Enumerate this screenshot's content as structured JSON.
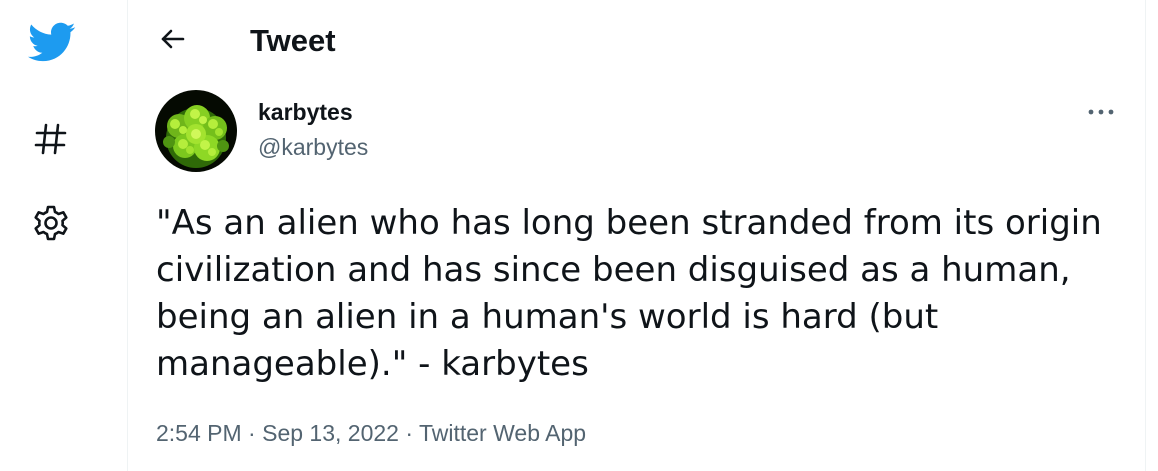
{
  "colors": {
    "brand": "#1d9bf0",
    "text_primary": "#0f1419",
    "text_secondary": "#536471",
    "border": "#eff3f4"
  },
  "nav": {
    "items": [
      {
        "icon": "twitter-bird-icon"
      },
      {
        "icon": "hashtag-icon"
      },
      {
        "icon": "gear-icon"
      }
    ]
  },
  "header": {
    "back_icon": "arrow-left-icon",
    "title": "Tweet"
  },
  "tweet": {
    "author": {
      "name": "karbytes",
      "handle": "@karbytes",
      "avatar_icon": "romanesco-broccoli-avatar"
    },
    "more_icon": "ellipsis-icon",
    "text": "\"As an alien who has long been stranded from its origin civilization and has since been disguised as a human, being an alien in a human's world is hard (but manageable).\" - karbytes",
    "time": "2:54 PM",
    "separator": " · ",
    "date": "Sep 13, 2022",
    "source": "Twitter Web App"
  }
}
